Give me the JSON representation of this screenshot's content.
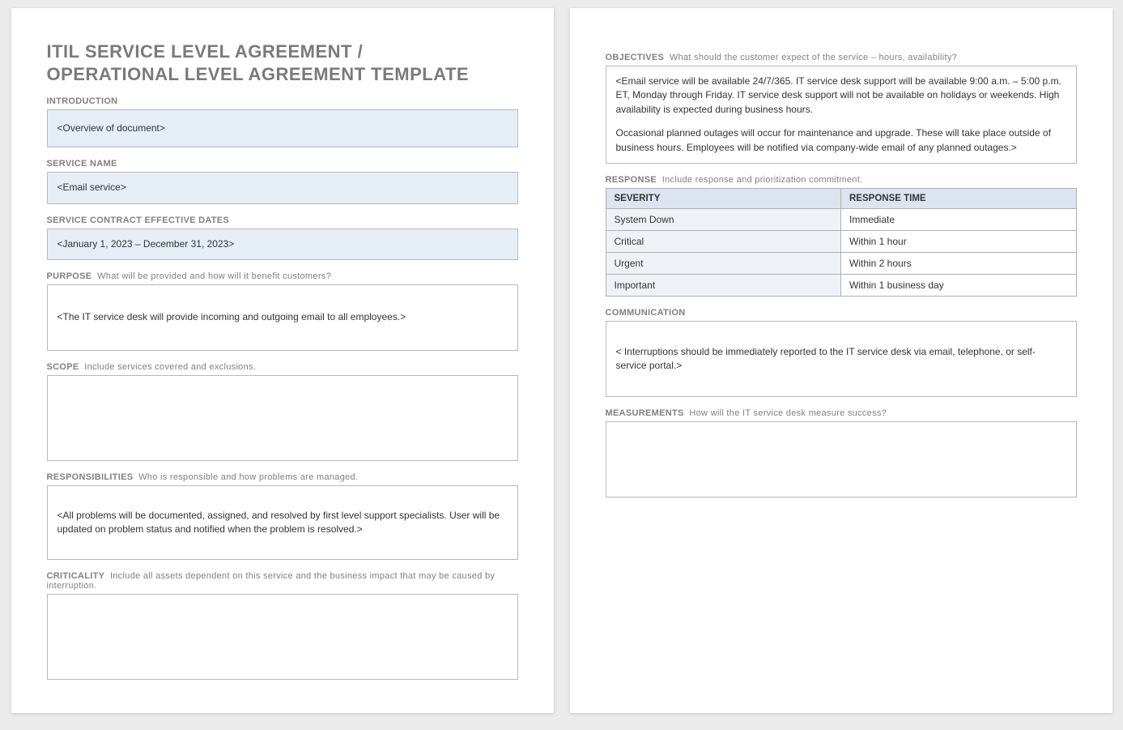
{
  "title_line1": "ITIL SERVICE LEVEL AGREEMENT /",
  "title_line2": "OPERATIONAL LEVEL AGREEMENT TEMPLATE",
  "sections": {
    "introduction": {
      "label": "INTRODUCTION",
      "value": "<Overview of document>"
    },
    "service_name": {
      "label": "SERVICE NAME",
      "value": "<Email service>"
    },
    "contract_dates": {
      "label": "SERVICE CONTRACT EFFECTIVE DATES",
      "value": "<January 1, 2023 – December 31, 2023>"
    },
    "purpose": {
      "label": "PURPOSE",
      "hint": "What will be provided and how will it benefit customers?",
      "value": "<The IT service desk will provide incoming and outgoing email to all employees.>"
    },
    "scope": {
      "label": "SCOPE",
      "hint": "Include services covered and exclusions.",
      "value": ""
    },
    "responsibilities": {
      "label": "RESPONSIBILITIES",
      "hint": "Who is responsible and how problems are managed.",
      "value": "<All problems will be documented, assigned, and resolved by first level support specialists. User will be updated on problem status and notified when the problem is resolved.>"
    },
    "criticality": {
      "label": "CRITICALITY",
      "hint": "Include all assets dependent on this service and the business impact that may be caused by interruption.",
      "value": ""
    },
    "objectives": {
      "label": "OBJECTIVES",
      "hint": "What should the customer expect of the service – hours, availability?",
      "para1": "<Email service will be available 24/7/365. IT service desk support will be available 9:00 a.m. – 5:00 p.m. ET, Monday through Friday. IT service desk support will not be available on holidays or weekends. High availability is expected during business hours.",
      "para2": "Occasional planned outages will occur for maintenance and upgrade. These will take place outside of business hours. Employees will be notified via company-wide email of any planned outages.>"
    },
    "response": {
      "label": "RESPONSE",
      "hint": "Include response and prioritization commitment."
    },
    "communication": {
      "label": "COMMUNICATION",
      "value": "< Interruptions should be immediately reported to the IT service desk via email, telephone, or self-service portal.>"
    },
    "measurements": {
      "label": "MEASUREMENTS",
      "hint": "How will the IT service desk measure success?",
      "value": ""
    }
  },
  "response_table": {
    "headers": {
      "severity": "SEVERITY",
      "response_time": "RESPONSE TIME"
    },
    "rows": [
      {
        "severity": "System Down",
        "response_time": "Immediate"
      },
      {
        "severity": "Critical",
        "response_time": "Within 1 hour"
      },
      {
        "severity": "Urgent",
        "response_time": "Within 2 hours"
      },
      {
        "severity": "Important",
        "response_time": "Within 1 business day"
      }
    ]
  }
}
